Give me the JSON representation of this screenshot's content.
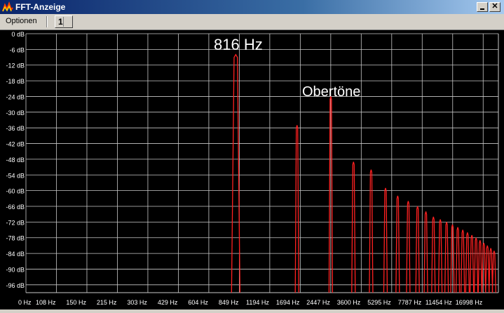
{
  "window": {
    "title": "FFT-Anzeige",
    "minimize_icon": "minimize-icon",
    "close_icon": "close-icon",
    "app_icon": "fft-app-icon"
  },
  "menu": {
    "options_label": "Optionen",
    "channel_label": "1"
  },
  "annotations": {
    "peak_label": "816 Hz",
    "overtones_label": "Obertöne"
  },
  "colors": {
    "background": "#000000",
    "grid": "#c8c8c8",
    "spectrum": "#ff2020",
    "text": "#ffffff"
  },
  "chart_data": {
    "type": "line",
    "title": "",
    "y_tick_labels": [
      "0 dB",
      "-6 dB",
      "-12 dB",
      "-18 dB",
      "-24 dB",
      "-30 dB",
      "-36 dB",
      "-42 dB",
      "-48 dB",
      "-54 dB",
      "-60 dB",
      "-66 dB",
      "-72 dB",
      "-78 dB",
      "-84 dB",
      "-90 dB",
      "-96 dB"
    ],
    "x_tick_labels": [
      "0 Hz",
      "108 Hz",
      "150 Hz",
      "215 Hz",
      "303 Hz",
      "429 Hz",
      "604 Hz",
      "849 Hz",
      "1194 Hz",
      "1694 Hz",
      "2447 Hz",
      "3600 Hz",
      "5295 Hz",
      "7787 Hz",
      "11454 Hz",
      "16998 Hz"
    ],
    "ylim": [
      -100,
      0
    ],
    "grid": true,
    "series": [
      {
        "values_x": [
          816,
          1632,
          2448,
          3264,
          4080,
          4896,
          5712,
          6528,
          7344,
          8160,
          8976,
          9792,
          10608,
          11424,
          12240,
          13056,
          13872,
          14688,
          15504,
          16320,
          17136,
          17952,
          18768,
          19584
        ],
        "values_db": [
          -8,
          -35,
          -24,
          -49,
          -52,
          -59,
          -62,
          -64,
          -66,
          -68,
          -70,
          -71,
          -72,
          -73,
          -74,
          -75,
          -76,
          -77,
          -78,
          -79,
          -80,
          -81,
          -82,
          -83
        ]
      }
    ]
  }
}
